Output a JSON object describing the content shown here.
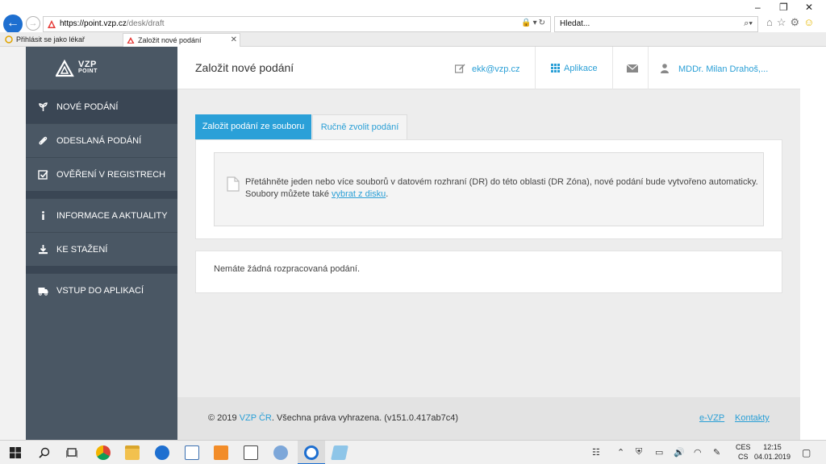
{
  "browser": {
    "url_host": "https://point.vzp.cz",
    "url_path": "/desk/draft",
    "search_placeholder": "Hledat...",
    "tabs": [
      {
        "label": "Přihlásit se jako lékař"
      },
      {
        "label": "Založit nové podání"
      }
    ]
  },
  "logo": {
    "text_top": "VZP",
    "text_bottom": "POINT"
  },
  "sidebar": {
    "items": [
      {
        "label": "NOVÉ PODÁNÍ"
      },
      {
        "label": "ODESLANÁ PODÁNÍ"
      },
      {
        "label": "OVĚŘENÍ V REGISTRECH"
      },
      {
        "label": "INFORMACE A AKTUALITY"
      },
      {
        "label": "KE STAŽENÍ"
      },
      {
        "label": "VSTUP DO APLIKACÍ"
      }
    ]
  },
  "header": {
    "title": "Založit nové podání",
    "email": "ekk@vzp.cz",
    "apps": "Aplikace",
    "user": "MDDr. Milan Drahoš,..."
  },
  "main": {
    "tab_active": "Založit podání ze souboru",
    "tab_inactive": "Ručně zvolit podání",
    "drop_text_1": "Přetáhněte jeden nebo více souborů v datovém rozhraní (DR) do této oblasti (DR Zóna), nové podání bude vytvořeno automaticky.",
    "drop_text_2": "Soubory můžete také",
    "drop_link": "vybrat z disku",
    "drop_end": ".",
    "empty_msg": "Nemáte žádná rozpracovaná podání."
  },
  "footer": {
    "copy_prefix": "© 2019",
    "copy_link": "VZP ČR",
    "copy_suffix": ". Všechna práva vyhrazena. (v151.0.417ab7c4)",
    "link_1": "e-VZP",
    "link_2": "Kontakty"
  },
  "taskbar": {
    "lang_1": "CES",
    "lang_2": "CS",
    "time": "12:15",
    "date": "04.01.2019"
  },
  "colors": {
    "accent": "#2aa0d8",
    "sidebar": "#4a5764",
    "sidebar_active": "#3a4654",
    "content_bg": "#ededed"
  }
}
